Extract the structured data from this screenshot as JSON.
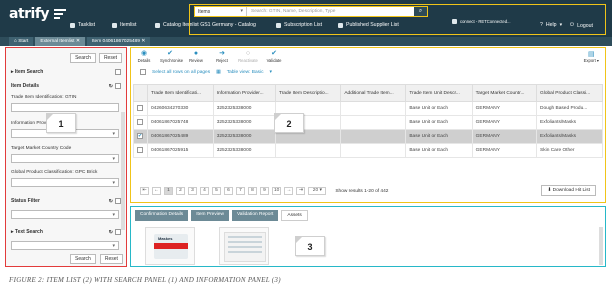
{
  "app": {
    "logo": "atrify"
  },
  "nav": {
    "items": [
      {
        "label": "Tasklist"
      },
      {
        "label": "Itemlist"
      },
      {
        "label": "Catalog Itemlist GS1 Germany - Catalog"
      },
      {
        "label": "Subscription List"
      },
      {
        "label": "Published Supplier List"
      }
    ],
    "connection": "connect - RETConnected...",
    "help": "Help",
    "logout": "Logout",
    "search": {
      "scope": "Items",
      "placeholder": "Search: GTIN, Name, Description, Type"
    }
  },
  "tabs": [
    {
      "label": "Start"
    },
    {
      "label": "External Itemlist"
    },
    {
      "label": "Item 04061867025489"
    }
  ],
  "search_panel": {
    "search_btn": "Search",
    "reset_btn": "Reset",
    "item_search": "Item Search",
    "item_details": "Item Details",
    "gtin_label": "Trade Item Identification: GTIN",
    "info_label": "Information Provider",
    "target_market_label": "Target Market Country Code",
    "gpc_label": "Global Product Classification: GPC Brick",
    "status_filter": "Status Filter",
    "text_search": "Text Search"
  },
  "toolbar": {
    "items": [
      {
        "label": "Details",
        "icon": "eye-icon"
      },
      {
        "label": "Synchronise",
        "icon": "check-icon"
      },
      {
        "label": "Review",
        "icon": "info-icon"
      },
      {
        "label": "Reject",
        "icon": "reject-icon"
      },
      {
        "label": "Reactivate",
        "icon": "circle-icon"
      },
      {
        "label": "Validate",
        "icon": "check-icon"
      }
    ],
    "export": "Export",
    "select_all": "Select all rows on all pages",
    "table_view": "Table view: Basic"
  },
  "table": {
    "columns": [
      "Trade Item Identificati...",
      "Information Provider...",
      "Trade Item Descriptio...",
      "Additional Trade Item...",
      "Trade Item Unit Descr...",
      "Target Market Countr...",
      "Global Product Classi..."
    ],
    "rows": [
      [
        "04260634270330",
        "3252325338000",
        "",
        "",
        "Base Unit or Each",
        "GERMANY",
        "Dough Based Produ..."
      ],
      [
        "04061867025748",
        "3252325338000",
        "",
        "",
        "Base Unit or Each",
        "GERMANY",
        "Exfoliants/Masks"
      ],
      [
        "04061867025489",
        "3252325338000",
        "",
        "",
        "Base Unit or Each",
        "GERMANY",
        "Exfoliants/Masks"
      ],
      [
        "04061867025915",
        "3252325338000",
        "",
        "",
        "Base Unit or Each",
        "GERMANY",
        "Skin Care Other"
      ]
    ]
  },
  "pager": {
    "pages": [
      "1",
      "2",
      "3",
      "4",
      "5",
      "6",
      "7",
      "8",
      "9",
      "10"
    ],
    "per_page": "20",
    "results": "Show results 1-20 of 442",
    "download": "Download Hit List"
  },
  "info_panel": {
    "tabs": [
      "Confirmation Details",
      "Item Preview",
      "Validation Report",
      "Assets"
    ],
    "product_label": "Maskes"
  },
  "callouts": [
    "1",
    "2",
    "3"
  ],
  "caption": "FIGURE 2: ITEM LIST (2) WITH SEARCH PANEL (1) AND INFORMATION PANEL (3)"
}
